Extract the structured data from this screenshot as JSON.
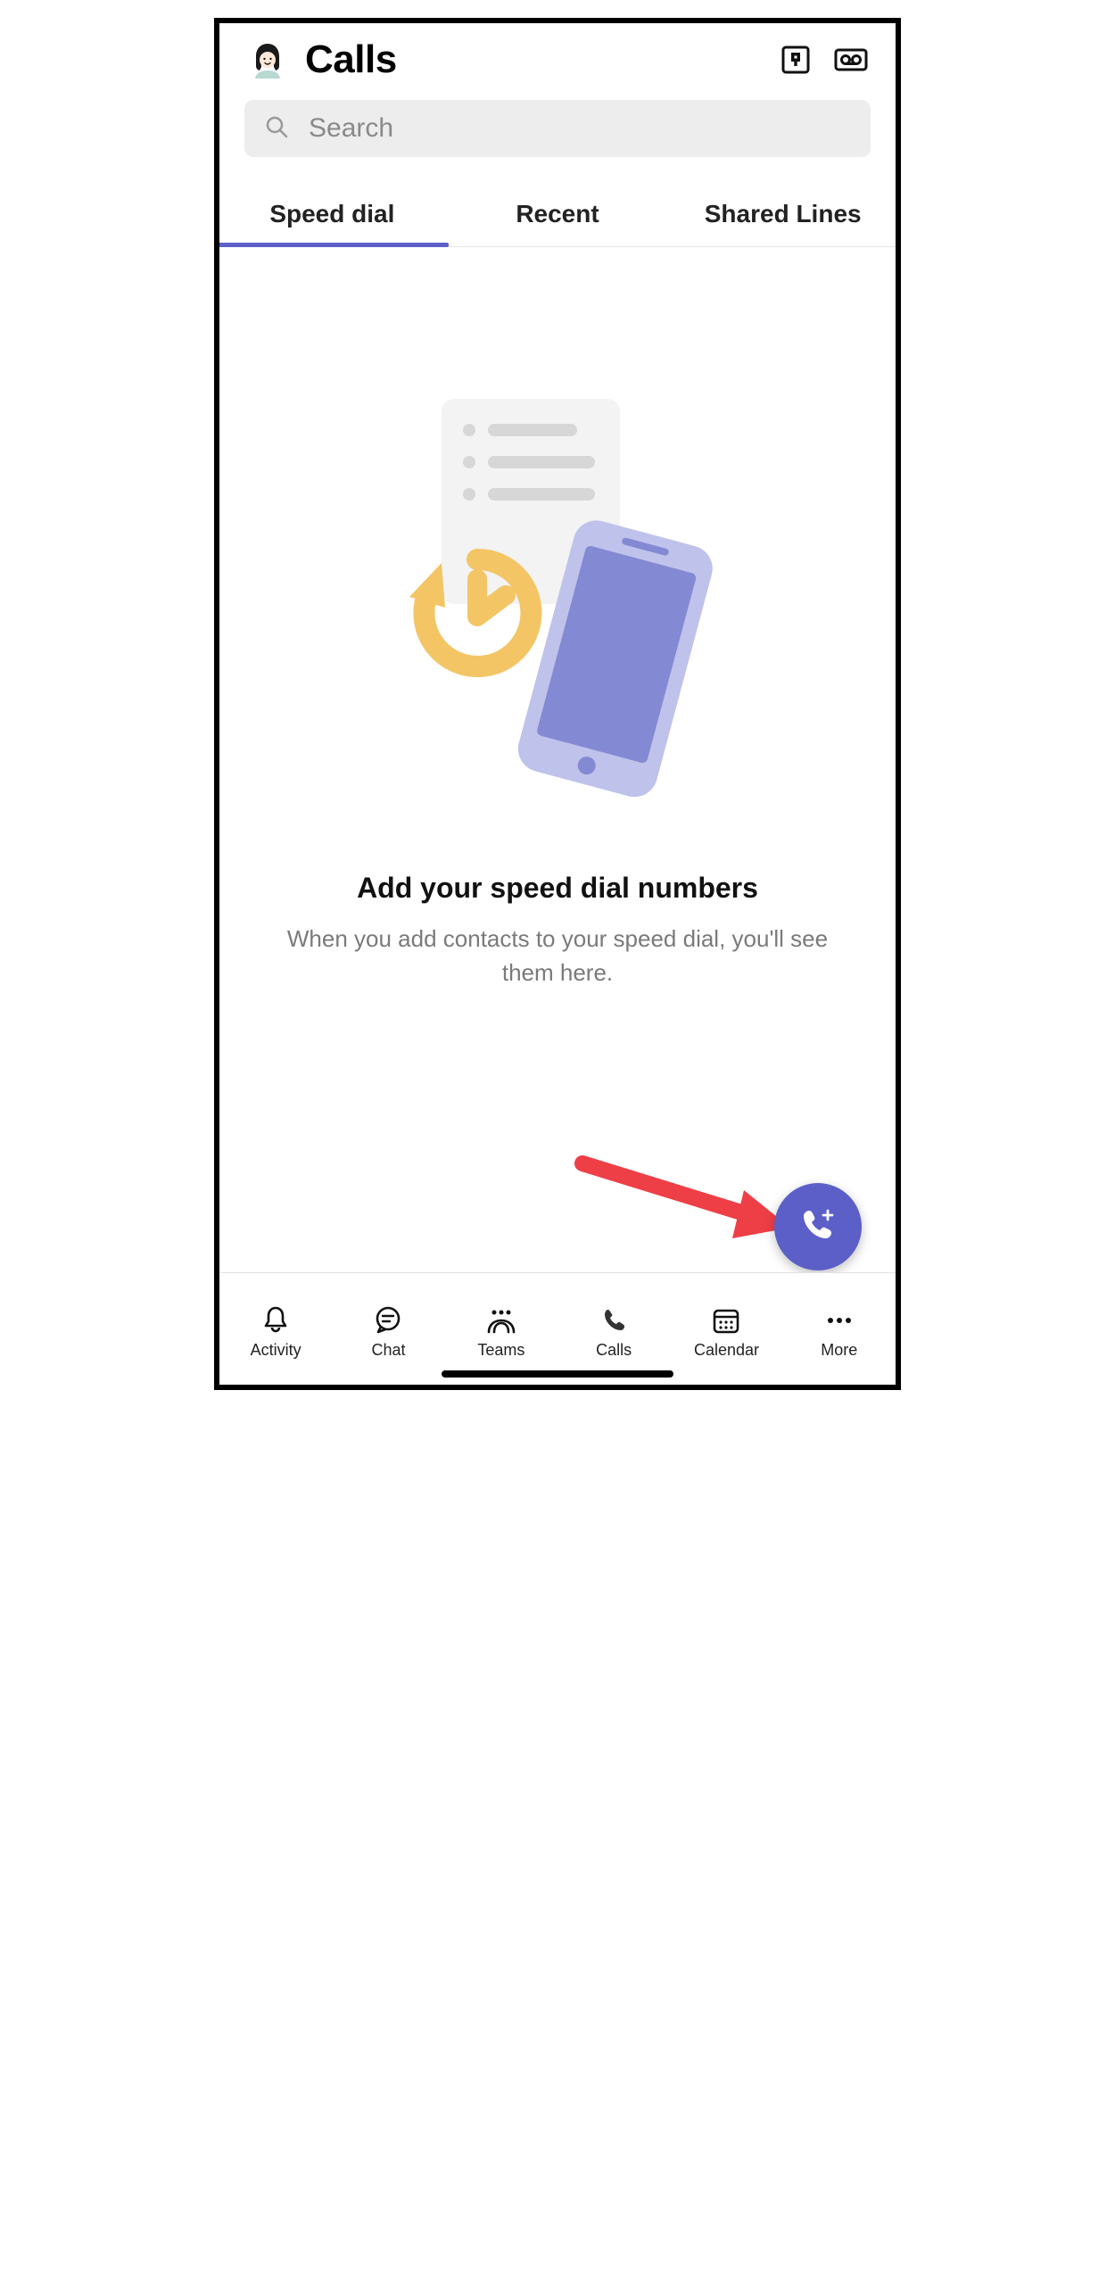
{
  "header": {
    "title": "Calls"
  },
  "search": {
    "placeholder": "Search",
    "value": ""
  },
  "tabs": [
    {
      "label": "Speed dial",
      "active": true
    },
    {
      "label": "Recent",
      "active": false
    },
    {
      "label": "Shared Lines",
      "active": false
    }
  ],
  "empty_state": {
    "title": "Add your speed dial numbers",
    "subtitle": "When you add contacts to your speed dial, you'll see them here."
  },
  "bottom_nav": [
    {
      "label": "Activity",
      "icon": "bell"
    },
    {
      "label": "Chat",
      "icon": "chat"
    },
    {
      "label": "Teams",
      "icon": "teams"
    },
    {
      "label": "Calls",
      "icon": "call",
      "highlight": true
    },
    {
      "label": "Calendar",
      "icon": "calendar"
    },
    {
      "label": "More",
      "icon": "more"
    }
  ],
  "colors": {
    "accent": "#5b5fc7",
    "highlight": "#fce94a",
    "arrow": "#ee3f47"
  },
  "annotation": {
    "arrow_points_to": "make-call-fab"
  }
}
